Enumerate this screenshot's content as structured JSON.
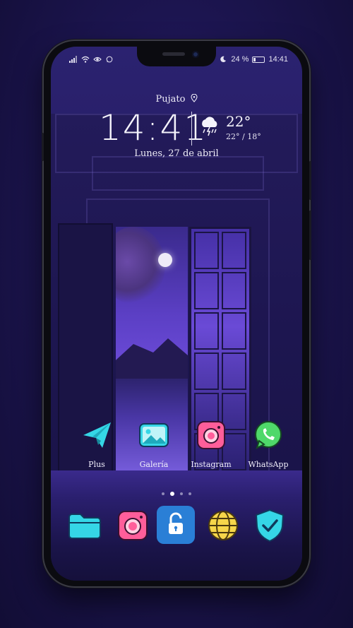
{
  "status_bar": {
    "battery_text": "24 %",
    "time": "14:41",
    "battery_level": 0.24,
    "icons_left": [
      "signal-icon",
      "wifi-icon",
      "eye-icon",
      "whatsapp-notification-icon"
    ],
    "icons_right": [
      "moon-icon",
      "battery-icon"
    ]
  },
  "widget": {
    "location": "Pujato",
    "time": "14:41",
    "temperature": "22°",
    "temp_range": "22° / 18°",
    "date": "Lunes, 27 de abril",
    "weather_icon": "rain-storm-icon"
  },
  "apps": [
    {
      "label": "Plus",
      "icon": "paper-plane-icon"
    },
    {
      "label": "Galería",
      "icon": "gallery-icon"
    },
    {
      "label": "Instagram",
      "icon": "camera-icon"
    },
    {
      "label": "WhatsApp",
      "icon": "whatsapp-icon"
    }
  ],
  "page_indicator": {
    "count": 4,
    "active": 1
  },
  "dock": [
    {
      "icon": "folder-icon"
    },
    {
      "icon": "camera-icon"
    },
    {
      "icon": "lock-icon"
    },
    {
      "icon": "globe-icon"
    },
    {
      "icon": "shield-check-icon"
    }
  ],
  "colors": {
    "accent_cyan": "#35d6e6",
    "accent_pink": "#ff5e9a",
    "accent_yellow": "#f6d64a",
    "accent_green": "#4fd86a",
    "lock_blue": "#2a7fd6"
  }
}
